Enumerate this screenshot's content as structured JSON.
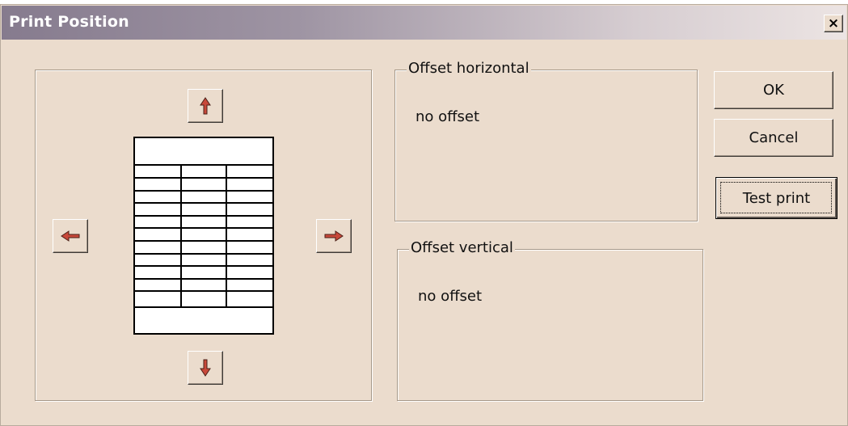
{
  "window": {
    "title": "Print Position",
    "close_label": "×"
  },
  "position_panel": {
    "arrows": [
      {
        "name": "up",
        "icon": "arrow-up-icon"
      },
      {
        "name": "down",
        "icon": "arrow-down-icon"
      },
      {
        "name": "left",
        "icon": "arrow-left-icon"
      },
      {
        "name": "right",
        "icon": "arrow-right-icon"
      }
    ],
    "preview": {
      "icon": "page-table-preview-icon",
      "columns": 3,
      "rows": 11
    }
  },
  "offset_horizontal": {
    "label": "Offset horizontal",
    "value": "no offset"
  },
  "offset_vertical": {
    "label": "Offset vertical",
    "value": "no offset"
  },
  "buttons": {
    "ok": "OK",
    "cancel": "Cancel",
    "test_print": "Test print"
  },
  "colors": {
    "dialog_background": "#ebdccd",
    "arrow_fill": "#c8483a"
  }
}
